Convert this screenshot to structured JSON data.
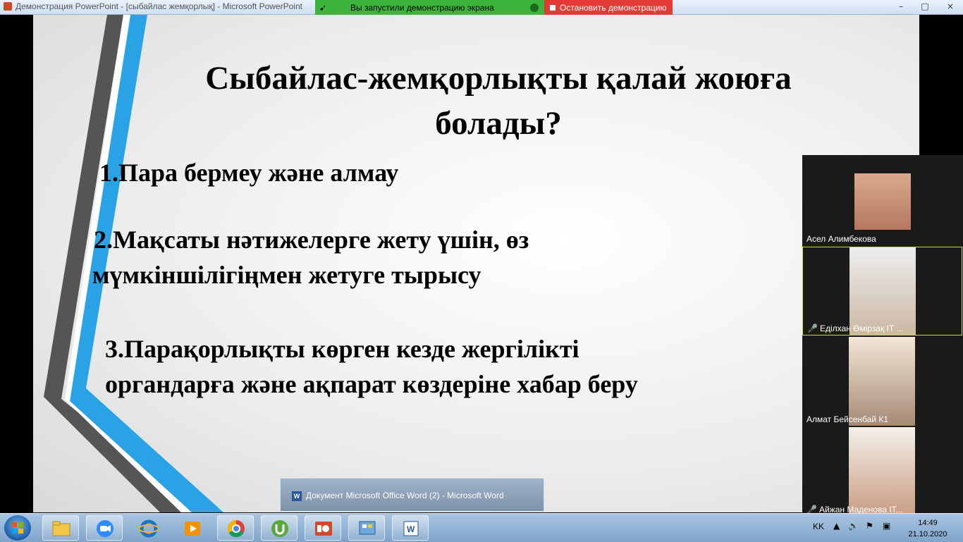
{
  "window": {
    "title": "Демонстрация PowerPoint - [сыбайлас жемқорлық] - Microsoft PowerPoint",
    "controls": [
      "–",
      "□",
      "×"
    ]
  },
  "share_bar": {
    "status_text": "Вы запустили демонстрацию экрана",
    "stop_label": "Остановить демонстрацию"
  },
  "slide": {
    "title_line1": "Сыбайлас-жемқорлықты  қалай жоюға",
    "title_line2": "болады?",
    "point1": "1.Пара бермеу және алмау",
    "point2_line1": "2.Мақсаты нәтижелерге жету  үшін,  өз",
    "point2_line2": "мүмкіншілігіңмен жетуге  тырысу",
    "point3_line1": "3.Парақорлықты көрген кезде жергілікті",
    "point3_line2": "органдарға және ақпарат көздеріне хабар беру"
  },
  "participants": [
    {
      "name": "Асел Алимбекова",
      "muted": false
    },
    {
      "name": "Еділхан Өмірзақ IT ...",
      "muted": true
    },
    {
      "name": "Алмат Бейсенбай К1",
      "muted": false
    },
    {
      "name": "Айжан Маденова IT...",
      "muted": true
    }
  ],
  "tooltip": {
    "text": "Документ Microsoft Office Word (2) - Microsoft Word"
  },
  "taskbar": {
    "apps": [
      "explorer-icon",
      "zoom-icon",
      "ie-icon",
      "media-player-icon",
      "chrome-icon",
      "utorrent-icon",
      "powerpoint-icon",
      "control-panel-icon",
      "word-icon"
    ],
    "lang": "KK",
    "time": "14:49",
    "date": "21.10.2020"
  },
  "colors": {
    "share_green": "#3db53d",
    "share_red": "#e53935",
    "active_speaker": "#c7d94a",
    "deco_blue": "#29a3e6",
    "deco_gray": "#555555"
  }
}
